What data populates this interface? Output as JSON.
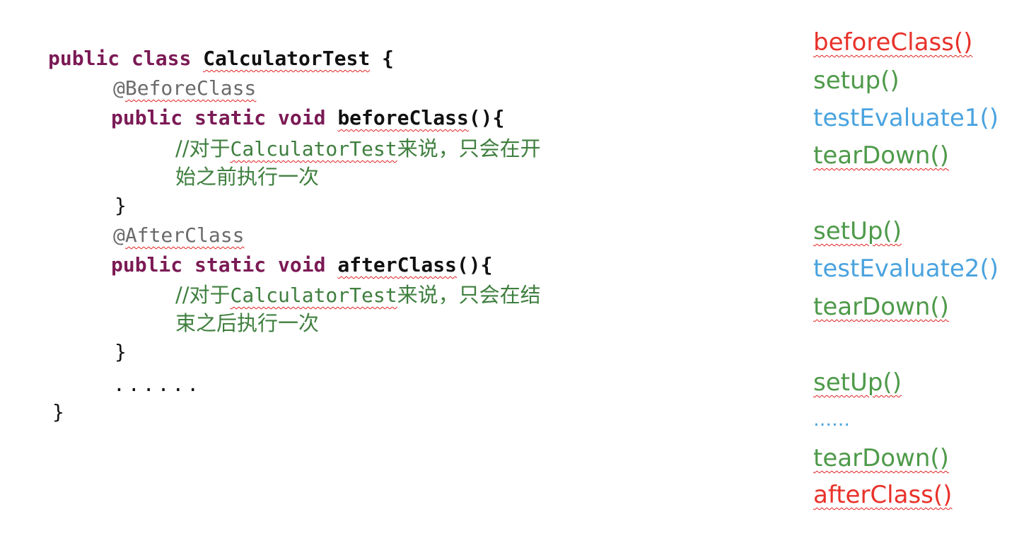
{
  "code": {
    "kw_public": "public",
    "kw_class": "class",
    "kw_static": "static",
    "kw_void": "void",
    "class_name": "CalculatorTest",
    "open_brace": "{",
    "close_brace": "}",
    "before_annotation_at": "@",
    "before_annotation": "BeforeClass",
    "before_method": "beforeClass",
    "paren_brace": "(){",
    "before_comment_prefix": "//对于",
    "before_comment_class": "CalculatorTest",
    "before_comment_line1_rest": "来说，只会在开",
    "before_comment_line2": "始之前执行一次",
    "after_annotation_at": "@",
    "after_annotation": "AfterClass",
    "after_method": "afterClass",
    "after_comment_prefix": "//对于",
    "after_comment_class": "CalculatorTest",
    "after_comment_line1_rest": "来说，只会在结",
    "after_comment_line2": "束之后执行一次",
    "ellipsis": "......"
  },
  "sequence": [
    {
      "text": "beforeClass()",
      "color": "#e8322a"
    },
    {
      "text": "setup()",
      "color": "#4e9a4a"
    },
    {
      "text": "testEvaluate1()",
      "color": "#4aa3df"
    },
    {
      "text": "tearDown()",
      "color": "#4e9a4a"
    },
    {
      "text": "setUp()",
      "color": "#4e9a4a"
    },
    {
      "text": "testEvaluate2()",
      "color": "#4aa3df"
    },
    {
      "text": "tearDown()",
      "color": "#4e9a4a"
    },
    {
      "text": "setUp()",
      "color": "#4e9a4a"
    },
    {
      "text": "……",
      "color": "#4aa3df"
    },
    {
      "text": "tearDown()",
      "color": "#4e9a4a"
    },
    {
      "text": "afterClass()",
      "color": "#e8322a"
    }
  ]
}
